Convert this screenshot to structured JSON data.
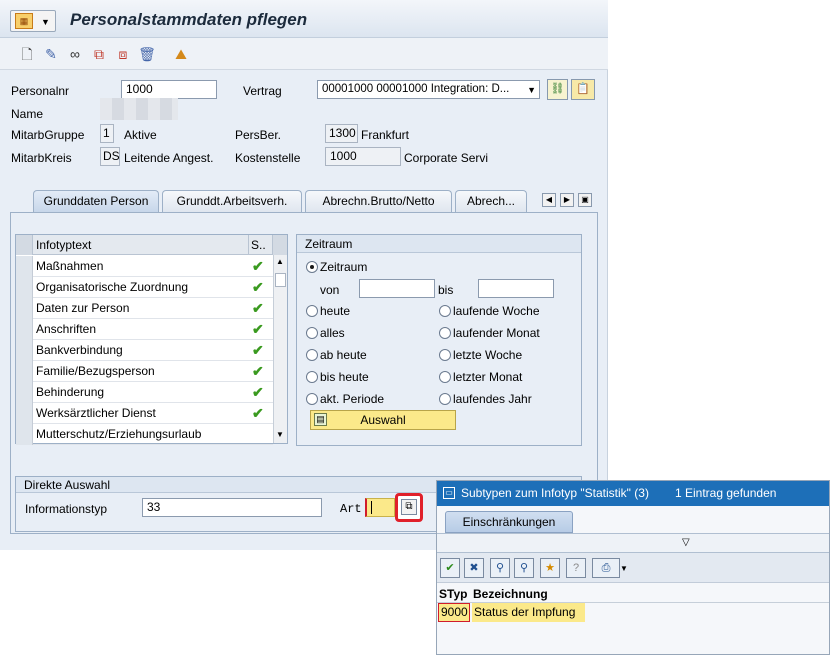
{
  "window": {
    "title": "Personalstammdaten pflegen"
  },
  "header": {
    "personalnr_label": "Personalnr",
    "personalnr_value": "1000",
    "vertrag_label": "Vertrag",
    "vertrag_value": "00001000 00001000 Integration: D...",
    "name_label": "Name",
    "mitarbgruppe_label": "MitarbGruppe",
    "mitarbgruppe_code": "1",
    "mitarbgruppe_text": "Aktive",
    "persber_label": "PersBer.",
    "persber_code": "1300",
    "persber_text": "Frankfurt",
    "mitarbkreis_label": "MitarbKreis",
    "mitarbkreis_code": "DS",
    "mitarbkreis_text": "Leitende Angest.",
    "kostenstelle_label": "Kostenstelle",
    "kostenstelle_code": "1000",
    "kostenstelle_text": "Corporate Servi"
  },
  "tabs": [
    {
      "label": "Grunddaten Person"
    },
    {
      "label": "Grunddt.Arbeitsverh."
    },
    {
      "label": "Abrechn.Brutto/Netto"
    },
    {
      "label": "Abrech..."
    }
  ],
  "infotypes": {
    "col_text": "Infotyptext",
    "col_status": "S..",
    "rows": [
      {
        "text": "Maßnahmen",
        "done": true
      },
      {
        "text": "Organisatorische Zuordnung",
        "done": true
      },
      {
        "text": "Daten zur Person",
        "done": true
      },
      {
        "text": "Anschriften",
        "done": true
      },
      {
        "text": "Bankverbindung",
        "done": true
      },
      {
        "text": "Familie/Bezugsperson",
        "done": true
      },
      {
        "text": "Behinderung",
        "done": true
      },
      {
        "text": "Werksärztlicher Dienst",
        "done": true
      },
      {
        "text": "Mutterschutz/Erziehungsurlaub",
        "done": false
      }
    ]
  },
  "zeitraum": {
    "title": "Zeitraum",
    "option_zeitraum": "Zeitraum",
    "von_label": "von",
    "bis_label": "bis",
    "opt_heute": "heute",
    "opt_laufende_woche": "laufende Woche",
    "opt_alles": "alles",
    "opt_laufender_monat": "laufender Monat",
    "opt_ab_heute": "ab heute",
    "opt_letzte_woche": "letzte Woche",
    "opt_bis_heute": "bis heute",
    "opt_letzter_monat": "letzter Monat",
    "opt_akt_periode": "akt. Periode",
    "opt_laufendes_jahr": "laufendes Jahr",
    "auswahl_label": "Auswahl"
  },
  "direkt": {
    "title": "Direkte Auswahl",
    "infotyp_label": "Informationstyp",
    "infotyp_value": "33",
    "art_label": "Art",
    "art_value": ""
  },
  "popup": {
    "title": "Subtypen zum Infotyp \"Statistik\" (3)",
    "count": "1 Eintrag gefunden",
    "tab_label": "Einschränkungen",
    "col_styp": "STyp",
    "col_bez": "Bezeichnung",
    "rows": [
      {
        "styp": "9000",
        "bez": "Status der Impfung"
      }
    ]
  },
  "colors": {
    "accent": "#1d6fb8",
    "check": "#3a9a1f",
    "highlight": "#e0202a",
    "selected_row": "#fbe98a"
  }
}
